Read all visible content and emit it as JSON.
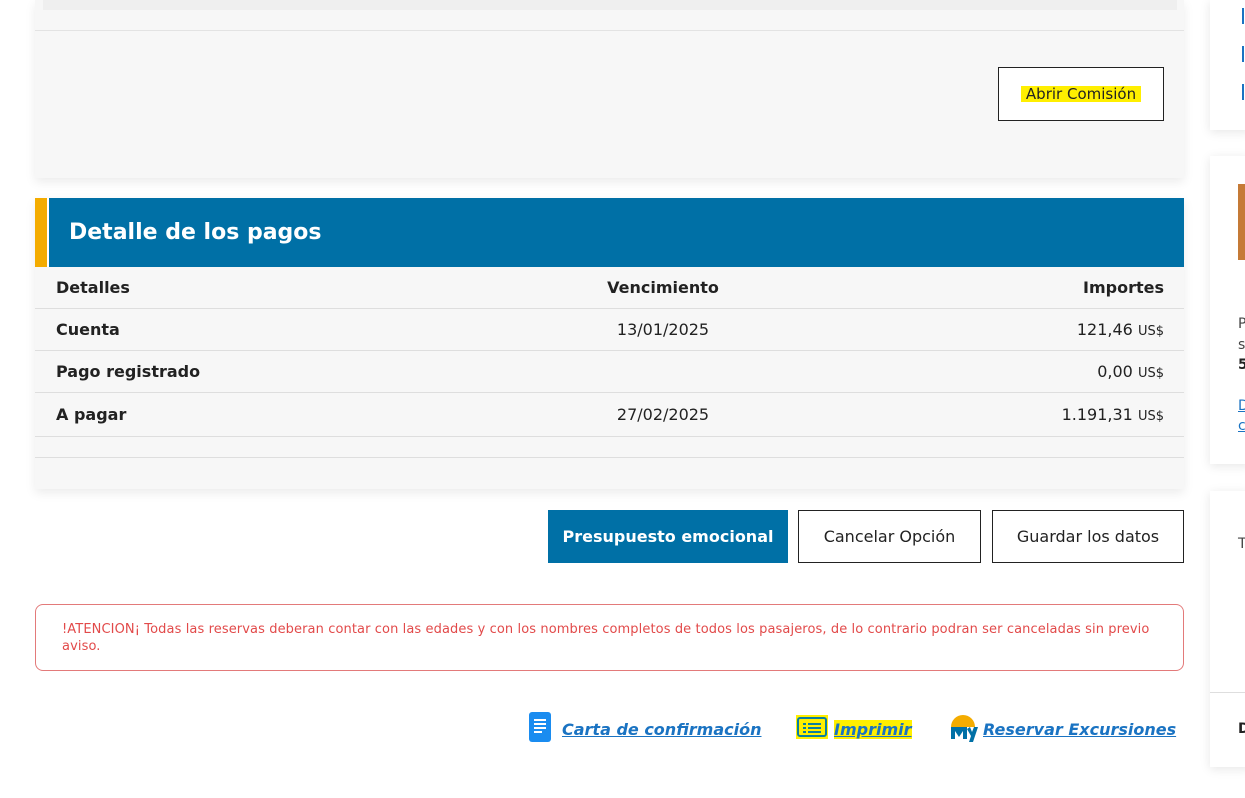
{
  "top_card": {
    "open_commission_label": "Abrir Comisión"
  },
  "payments": {
    "title": "Detalle de los pagos",
    "columns": [
      "Detalles",
      "Vencimiento",
      "Importes"
    ],
    "rows": [
      {
        "detail": "Cuenta",
        "due": "13/01/2025",
        "amount": "121,46",
        "currency": "US$"
      },
      {
        "detail": "Pago registrado",
        "due": "",
        "amount": "0,00",
        "currency": "US$"
      },
      {
        "detail": "A pagar",
        "due": "27/02/2025",
        "amount": "1.191,31",
        "currency": "US$"
      }
    ]
  },
  "actions": {
    "budget_label": "Presupuesto emocional",
    "cancel_label": "Cancelar Opción",
    "save_label": "Guardar los datos"
  },
  "warning": {
    "text": "!ATENCION¡ Todas las reservas deberan contar con las edades y con los nombres completos de todos los pasajeros, de lo contrario podran ser canceladas sin previo aviso."
  },
  "links": {
    "confirmation_label": "Carta de confirmación",
    "print_label": "Imprimir",
    "excursions_label": "Reservar Excursiones",
    "confirmation_icon": "document-icon",
    "print_icon": "list-icon",
    "excursions_icon": "my-logo-icon"
  },
  "sidebar": {
    "card2": {
      "line1": "P",
      "line2": "s",
      "line3": "5",
      "link1": "D",
      "link2": "c"
    },
    "card3": {
      "line1": "T",
      "line2": "D"
    }
  },
  "colors": {
    "primary": "#0070a6",
    "accent": "#f4ac00",
    "highlight": "#ffef00",
    "warning": "#e24a4a",
    "link": "#1a73c2"
  }
}
